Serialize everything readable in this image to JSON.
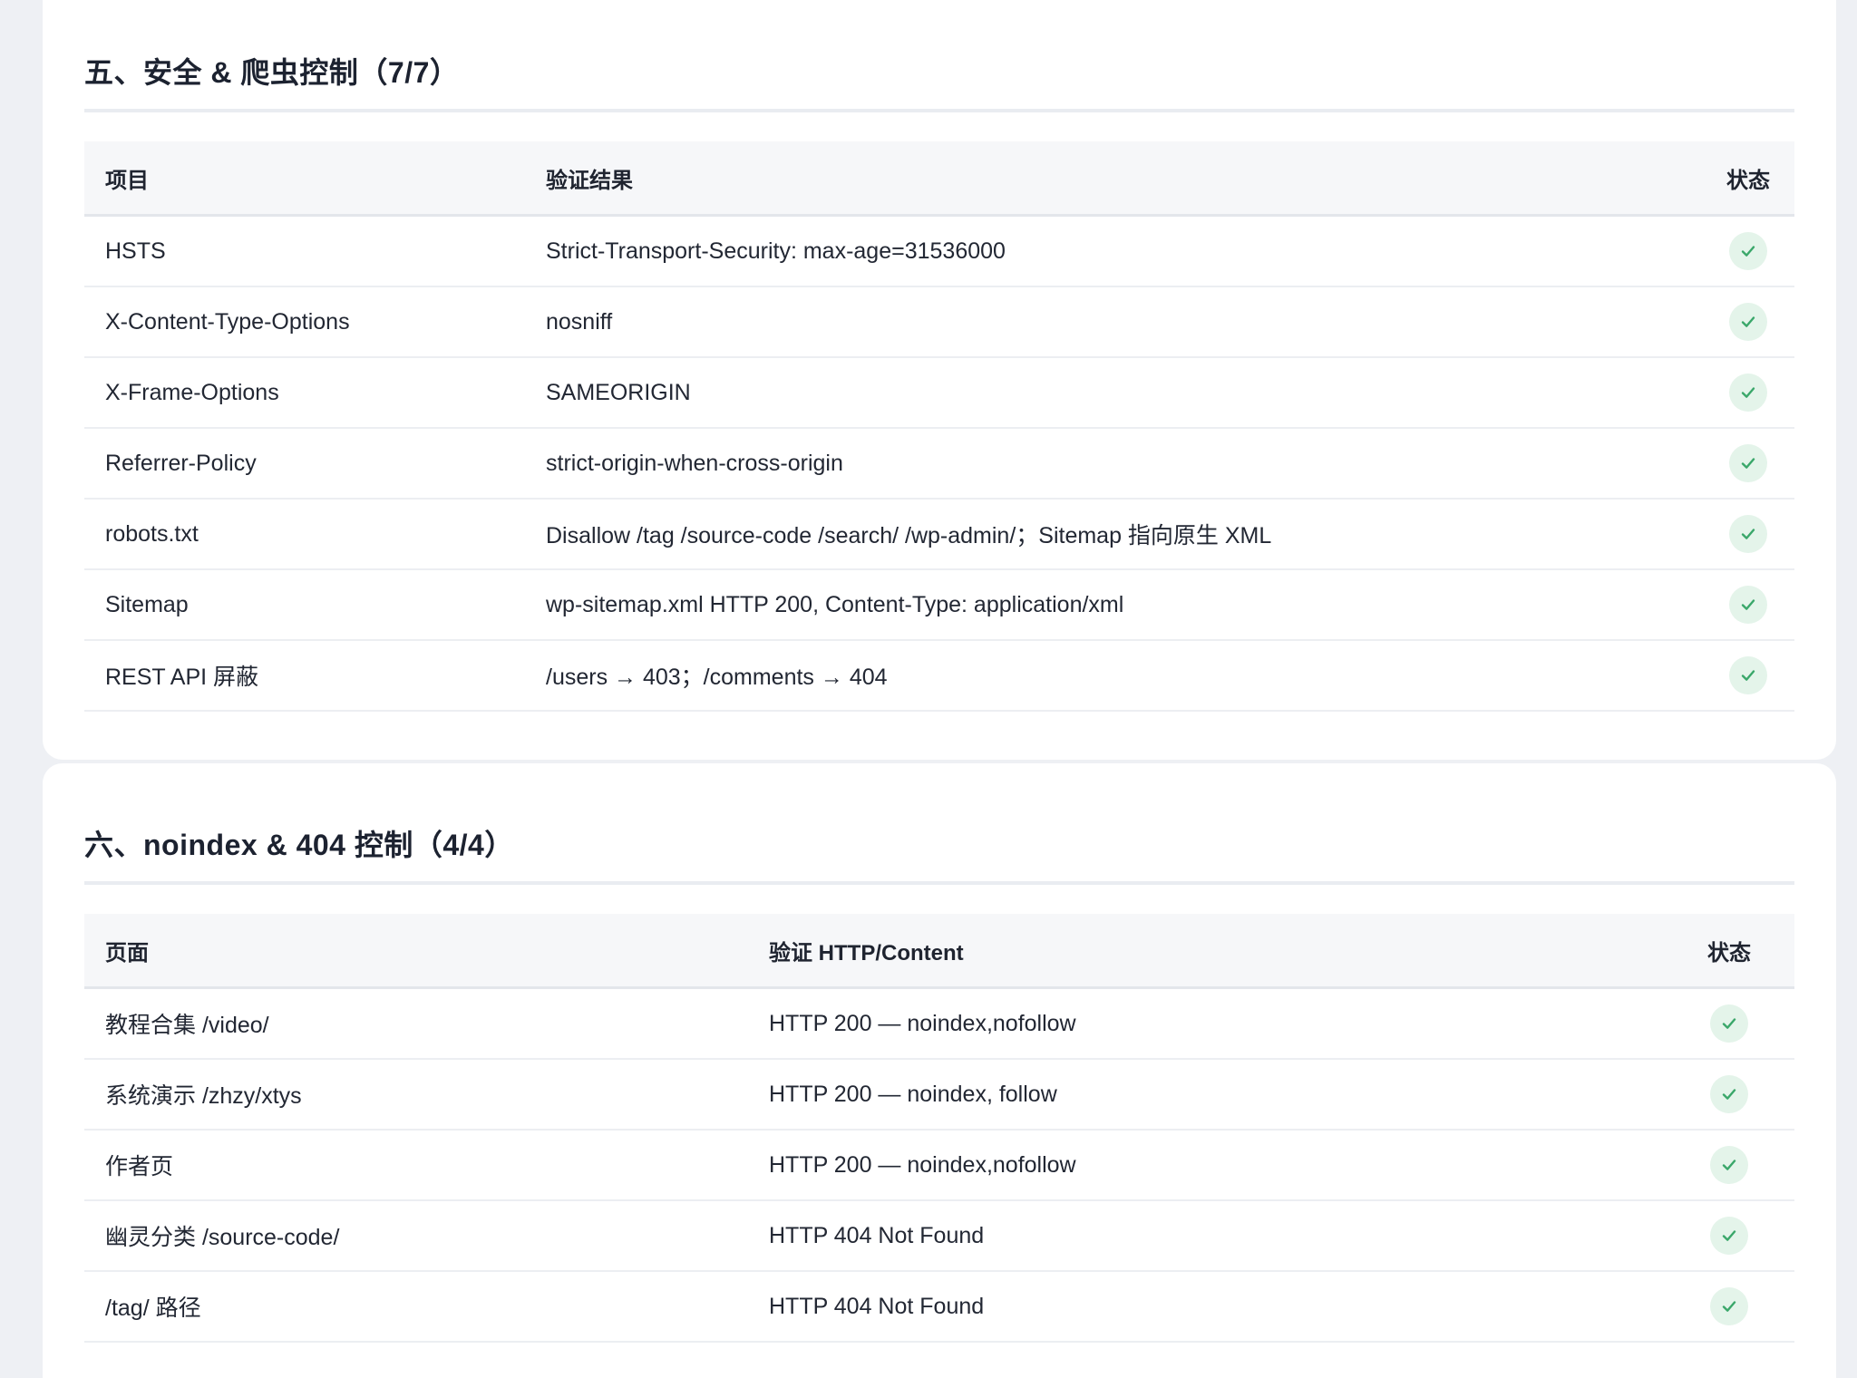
{
  "security": {
    "title": "五、安全 & 爬虫控制（7/7）",
    "headers": {
      "item": "项目",
      "result": "验证结果",
      "status": "状态"
    },
    "rows": [
      {
        "item": "HSTS",
        "result": "Strict-Transport-Security: max-age=31536000",
        "status": "ok"
      },
      {
        "item": "X-Content-Type-Options",
        "result": "nosniff",
        "status": "ok"
      },
      {
        "item": "X-Frame-Options",
        "result": "SAMEORIGIN",
        "status": "ok"
      },
      {
        "item": "Referrer-Policy",
        "result": "strict-origin-when-cross-origin",
        "status": "ok"
      },
      {
        "item": "robots.txt",
        "result": "Disallow /tag /source-code /search/ /wp-admin/；Sitemap 指向原生 XML",
        "status": "ok"
      },
      {
        "item": "Sitemap",
        "result": "wp-sitemap.xml HTTP 200, Content-Type: application/xml",
        "status": "ok"
      },
      {
        "item": "REST API 屏蔽",
        "result": "/users → 403；/comments → 404",
        "status": "ok"
      }
    ]
  },
  "noindex": {
    "title": "六、noindex & 404 控制（4/4）",
    "headers": {
      "page": "页面",
      "verify": "验证 HTTP/Content",
      "status": "状态"
    },
    "rows": [
      {
        "page": "教程合集 /video/",
        "verify": "HTTP 200 — noindex,nofollow",
        "status": "ok"
      },
      {
        "page": "系统演示 /zhzy/xtys",
        "verify": "HTTP 200 — noindex, follow",
        "status": "ok"
      },
      {
        "page": "作者页",
        "verify": "HTTP 200 — noindex,nofollow",
        "status": "ok"
      },
      {
        "page": "幽灵分类 /source-code/",
        "verify": "HTTP 404 Not Found",
        "status": "ok"
      },
      {
        "page": "/tag/ 路径",
        "verify": "HTTP 404 Not Found",
        "status": "ok"
      }
    ]
  },
  "colors": {
    "check_bg": "#e4f4ea",
    "check_mark": "#3aa76a"
  },
  "icons": {
    "status_ok": "check-circle-icon"
  }
}
